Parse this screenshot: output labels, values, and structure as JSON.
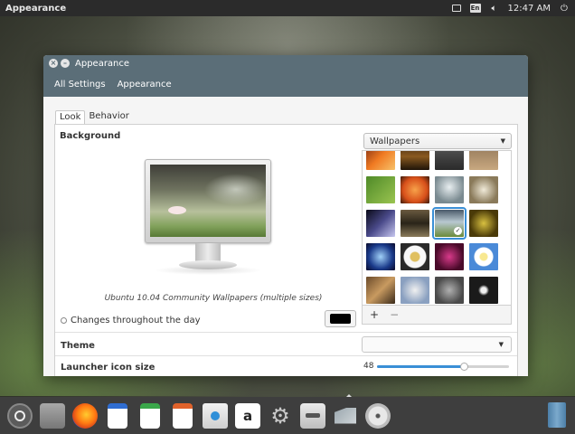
{
  "top_panel": {
    "app_name": "Appearance",
    "indicators": [
      "mail-icon",
      "keyboard-layout-icon",
      "volume-icon",
      "power-icon"
    ],
    "keyboard_layout": "En",
    "clock": "12:47 AM"
  },
  "window": {
    "title": "Appearance",
    "breadcrumbs": [
      "All Settings",
      "Appearance"
    ],
    "tabs": [
      {
        "label": "Look",
        "active": true
      },
      {
        "label": "Behavior",
        "active": false
      }
    ],
    "background": {
      "label": "Background",
      "wallpaper_caption": "Ubuntu 10.04 Community Wallpapers (multiple sizes)",
      "changes_label": "Changes throughout the day",
      "color_swatch": "#000000"
    },
    "wallpapers": {
      "selected_source": "Wallpapers",
      "thumbnails": [
        {
          "name": "wallpaper-orange-leaves",
          "color": "linear-gradient(135deg,#7a2a12,#f07a22,#f7c26a)"
        },
        {
          "name": "wallpaper-dark-sunset",
          "color": "linear-gradient(#3a2410,#8a5a20,#1e1408)"
        },
        {
          "name": "wallpaper-grey-forest",
          "color": "linear-gradient(#5a5a5a,#2a2a2a)"
        },
        {
          "name": "wallpaper-sand",
          "color": "linear-gradient(#8f7456,#c8a880)"
        },
        {
          "name": "wallpaper-green-leaf",
          "color": "linear-gradient(135deg,#4f8a28,#9ac450)"
        },
        {
          "name": "wallpaper-orange-flower",
          "color": "radial-gradient(circle,#f7a24a,#d8501a 60%,#3a1a0a)"
        },
        {
          "name": "wallpaper-misty-light",
          "color": "radial-gradient(circle at 50% 40%,#e8eef0,#7a8a90 70%)"
        },
        {
          "name": "wallpaper-white-flower",
          "color": "radial-gradient(circle,#f0ead8,#8a7a5a 70%)"
        },
        {
          "name": "wallpaper-blue-lights",
          "color": "linear-gradient(135deg,#0a0a18,#4a4a8a,#c8c8f0)"
        },
        {
          "name": "wallpaper-wood-grain",
          "color": "linear-gradient(#6a5a40,#2a2418,#8a7a5a)"
        },
        {
          "name": "wallpaper-selected-green-field",
          "color": "linear-gradient(#4a5a6a,#b8c8d0 45%,#6a8a3a)"
        },
        {
          "name": "wallpaper-yellow-petals",
          "color": "radial-gradient(circle,#d8c040,#4a3a08 70%)"
        },
        {
          "name": "wallpaper-blue-tunnel",
          "color": "radial-gradient(circle,#a0d0f8,#1a3a8a 60%,#0a0a2a)"
        },
        {
          "name": "wallpaper-daisy",
          "color": "radial-gradient(circle,#e0c060 0 5px,#f8f8f8 6px 12px,#2a2a2a 13px)"
        },
        {
          "name": "wallpaper-pink-flower",
          "color": "radial-gradient(circle,#d83a8a,#4a0a2a 70%)"
        },
        {
          "name": "wallpaper-white-daisy-sky",
          "color": "radial-gradient(circle,#f8e890 0 4px,#ffffff 5px 10px,#4a8ad8 11px)"
        },
        {
          "name": "wallpaper-brown-leaves",
          "color": "linear-gradient(135deg,#6a4a2a,#c89a60,#3a2a1a)"
        },
        {
          "name": "wallpaper-dandelion",
          "color": "radial-gradient(circle,#f0f0f0,#8aa0c0 70%)"
        },
        {
          "name": "wallpaper-pebbles",
          "color": "radial-gradient(circle,#b0b0b0,#4a4a4a 70%)"
        },
        {
          "name": "wallpaper-dark-flower",
          "color": "radial-gradient(circle,#f0f0f0 0 3px,#1a1a1a 6px)"
        }
      ],
      "selected_index": 10
    },
    "theme": {
      "label": "Theme",
      "value": ""
    },
    "launcher": {
      "label": "Launcher icon size",
      "value": "48",
      "fraction": 0.66
    }
  },
  "dock": {
    "items": [
      "ubuntu-logo-icon",
      "files-icon",
      "firefox-icon",
      "writer-icon",
      "calc-icon",
      "impress-icon",
      "software-center-icon",
      "amazon-icon",
      "system-settings-icon",
      "toggle-icon",
      "appearance-icon",
      "disc-icon"
    ],
    "amazon_glyph": "a",
    "trash": "trash-icon"
  }
}
